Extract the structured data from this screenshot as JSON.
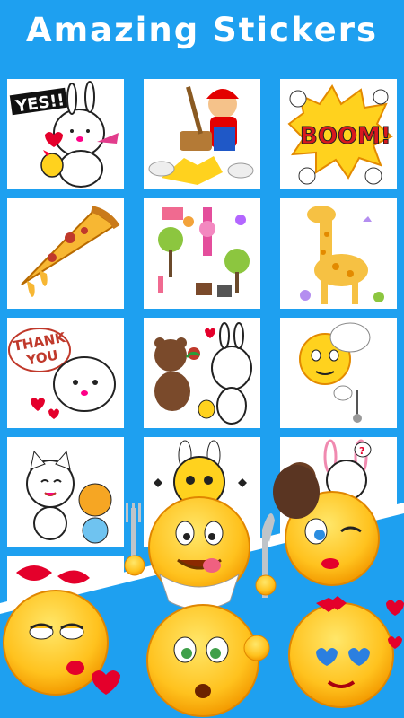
{
  "headline": "Amazing  Stickers",
  "tiles": {
    "yes_text": "YES!!",
    "boom_text": "BOOM!",
    "thank_you_line1": "THANK",
    "thank_you_line2": "YOU",
    "question_mark": "?"
  },
  "colors": {
    "background": "#1ea0f0",
    "tile": "#ffffff",
    "emoji_yellow": "#ffd21e",
    "emoji_orange": "#f4a300"
  }
}
